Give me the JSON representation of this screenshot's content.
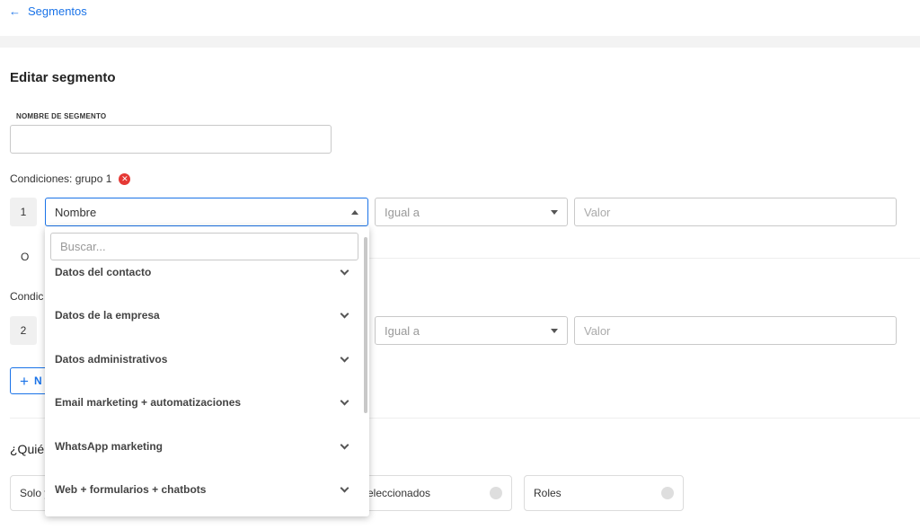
{
  "nav": {
    "back_label": "Segmentos"
  },
  "page": {
    "title": "Editar segmento"
  },
  "form": {
    "name_label": "NOMBRE DE SEGMENTO",
    "name_value": ""
  },
  "group1": {
    "label": "Condiciones: grupo 1",
    "row_number": "1",
    "field_value": "Nombre",
    "operator_value": "Igual a",
    "value_placeholder": "Valor"
  },
  "or_label": "O",
  "group2": {
    "label_partial": "Condic",
    "row_number": "2",
    "operator_value": "Igual a",
    "value_placeholder": "Valor"
  },
  "new_button": {
    "label_partial": "N"
  },
  "who": {
    "label_partial": "¿Quién"
  },
  "options": [
    {
      "label": "Solo y"
    },
    {
      "label": "eleccionados"
    },
    {
      "label": "Roles"
    }
  ],
  "dropdown": {
    "search_placeholder": "Buscar...",
    "items": [
      {
        "label": "Datos del contacto"
      },
      {
        "label": "Datos de la empresa"
      },
      {
        "label": "Datos administrativos"
      },
      {
        "label": "Email marketing + automatizaciones"
      },
      {
        "label": "WhatsApp marketing"
      },
      {
        "label": "Web + formularios + chatbots"
      }
    ]
  },
  "colors": {
    "accent": "#1a73e8",
    "danger": "#e53935"
  }
}
